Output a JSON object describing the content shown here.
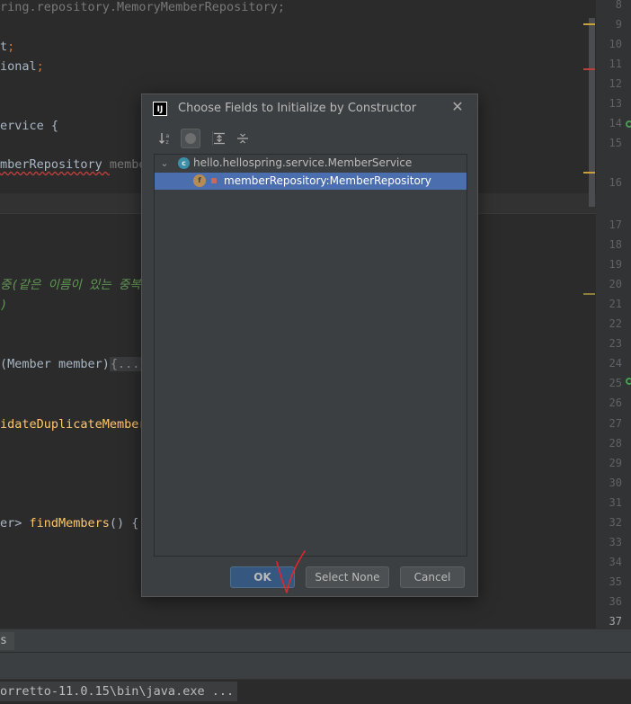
{
  "editor": {
    "lines": [
      {
        "n": "8",
        "html": "",
        "parts": [
          {
            "t": "ring.repository.MemoryMemberRepository;",
            "c": "dim"
          }
        ]
      },
      {
        "n": "9",
        "parts": []
      },
      {
        "n": "10",
        "parts": [
          {
            "t": "t",
            "c": ""
          },
          {
            "t": ";",
            "c": "kw"
          }
        ]
      },
      {
        "n": "11",
        "parts": [
          {
            "t": "ional",
            "c": ""
          },
          {
            "t": ";",
            "c": "kw"
          }
        ]
      },
      {
        "n": "12",
        "parts": []
      },
      {
        "n": "13",
        "parts": []
      },
      {
        "n": "14",
        "parts": [
          {
            "t": "ervice {",
            "c": ""
          }
        ]
      },
      {
        "n": "15",
        "parts": []
      },
      {
        "n": "16",
        "parts": [
          {
            "t": "mberRepository ",
            "c": "wavy"
          },
          {
            "t": "membe",
            "c": "dim"
          }
        ]
      }
    ],
    "lower_lines": [
      {
        "n": "17",
        "parts": []
      },
      {
        "n": "18",
        "parts": []
      },
      {
        "n": "19",
        "parts": []
      },
      {
        "n": "20",
        "parts": [
          {
            "t": "중(같은 이름이 있는 중복",
            "c": "cm"
          }
        ]
      },
      {
        "n": "21",
        "parts": [
          {
            "t": ")",
            "c": "cm"
          }
        ]
      },
      {
        "n": "22",
        "parts": []
      },
      {
        "n": "23",
        "parts": []
      },
      {
        "n": "24",
        "parts": [
          {
            "t": "(Member member)",
            "c": ""
          },
          {
            "t": "{...}",
            "c": "fold"
          }
        ]
      },
      {
        "n": "25",
        "parts": []
      },
      {
        "n": "26",
        "parts": []
      },
      {
        "n": "27",
        "parts": [
          {
            "t": "idateDuplicateMember",
            "c": "fn"
          }
        ]
      },
      {
        "n": "28",
        "parts": []
      },
      {
        "n": "29",
        "parts": []
      },
      {
        "n": "30",
        "parts": []
      },
      {
        "n": "31",
        "parts": []
      },
      {
        "n": "32",
        "parts": [
          {
            "t": "er> ",
            "c": ""
          },
          {
            "t": "findMembers",
            "c": "fn"
          },
          {
            "t": "() { ",
            "c": ""
          }
        ]
      },
      {
        "n": "33",
        "parts": []
      },
      {
        "n": "34",
        "parts": []
      },
      {
        "n": "35",
        "parts": []
      },
      {
        "n": "36",
        "parts": []
      },
      {
        "n": "37",
        "parts": []
      }
    ]
  },
  "bottom": {
    "tab_label": "s",
    "console_text": "orretto-11.0.15\\bin\\java.exe ..."
  },
  "dialog": {
    "title": "Choose Fields to Initialize by Constructor",
    "app_icon": "IJ",
    "close_glyph": "✕",
    "toolbar": {
      "sort_icon": "↓ª",
      "collapse_glyph": "⊻",
      "expand_glyph": "⊼"
    },
    "tree": {
      "class_name": "hello.hellospring.service.MemberService",
      "class_icon_letter": "c",
      "field_icon_letter": "f",
      "field_name": "memberRepository:MemberRepository"
    },
    "buttons": {
      "ok": "OK",
      "select_none": "Select None",
      "cancel": "Cancel"
    }
  },
  "colors": {
    "accent": "#4b6eaf",
    "ok_button": "#365880",
    "annotation_red": "#e3262b"
  }
}
